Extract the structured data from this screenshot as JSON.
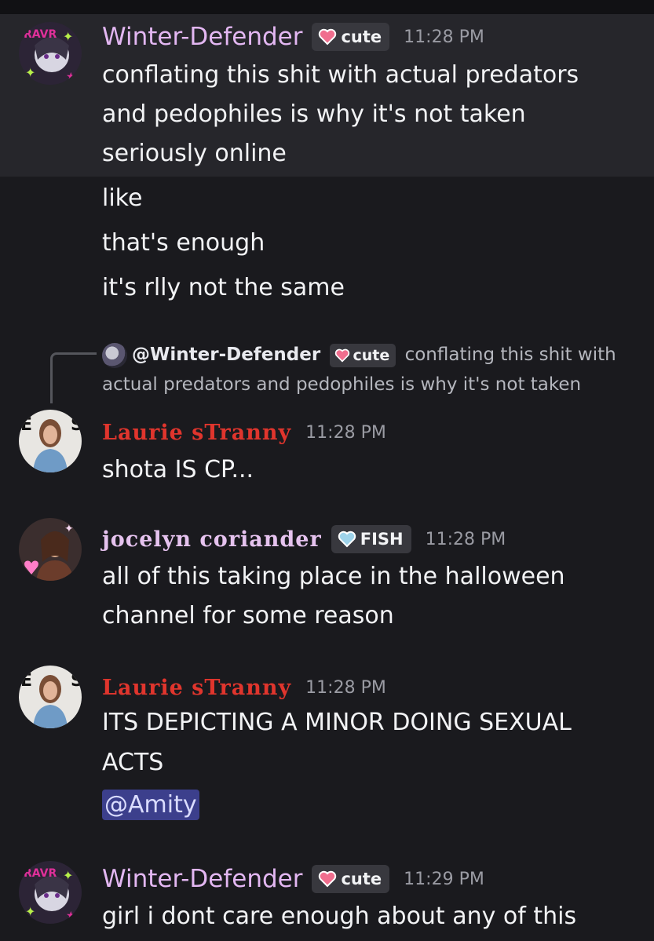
{
  "colors": {
    "background": "#1a1a1e",
    "highlight": "#26262b",
    "winter_name": "#e3b7f2",
    "laurie_name": "#e0352d",
    "jocelyn_name": "#e5c2ee",
    "timestamp": "#9a9ba3",
    "mention_bg": "#3c3f8c"
  },
  "messages": [
    {
      "author": "Winter-Defender",
      "tag": {
        "icon": "pink-heart-icon",
        "label": "cute"
      },
      "time": "11:28 PM",
      "lines": [
        "conflating this shit with actual predators",
        "and pedophiles is why it's not taken",
        "seriously online"
      ],
      "followups": [
        "like",
        "that's enough",
        "it's rlly not the same"
      ]
    },
    {
      "reply": {
        "author": "@Winter-Defender",
        "tag": "cute",
        "text_1": "conflating this shit with",
        "text_2": "actual predators and pedophiles is why it's not taken"
      },
      "author": "Laurie sTranny",
      "time": "11:28 PM",
      "lines": [
        "shota IS CP..."
      ]
    },
    {
      "author": "jocelyn coriander",
      "tag": {
        "icon": "blue-heart-icon",
        "label": "FISH"
      },
      "time": "11:28 PM",
      "lines": [
        "all of this taking place in the halloween",
        "channel for some reason"
      ]
    },
    {
      "author": "Laurie sTranny",
      "time": "11:28 PM",
      "lines": [
        "ITS DEPICTING A MINOR DOING SEXUAL",
        "ACTS"
      ],
      "mention": "@Amity"
    },
    {
      "author": "Winter-Defender",
      "tag": {
        "icon": "pink-heart-icon",
        "label": "cute"
      },
      "time": "11:29 PM",
      "lines": [
        "girl i dont care enough about any of this"
      ]
    }
  ]
}
